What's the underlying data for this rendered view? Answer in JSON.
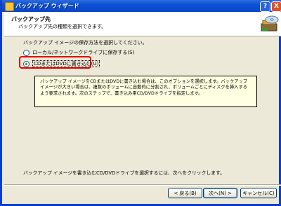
{
  "window": {
    "title": "バックアップ ウィザード",
    "help_label": "?",
    "close_label": "X"
  },
  "header": {
    "title": "バックアップ先",
    "subtitle": "バックアップ先の種類を選択できます。"
  },
  "content": {
    "prompt": "バックアップ イメージの保存方法を選択してください。",
    "options": [
      {
        "label": "ローカル/ネットワークドライブに保存する(S)",
        "selected": false
      },
      {
        "label": "CDまたはDVDに書き込む(U)",
        "selected": true
      }
    ],
    "info_text": "バックアップ イメージをCDまたはDVDに書き込む場合は、このオプションを選択します。バックアップ イメージが大きい場合は、複数のボリュームに自動的に分割され、ボリュームごとにディスクを挿入するよう要求されます。次のステップで、書き込み用CD/DVDドライブを指定します。",
    "footer_note": "バックアップ イメージを書き込むCD/DVDドライブを選択するには、次へをクリックします。"
  },
  "buttons": {
    "back": "< 戻る(B)",
    "next": "次へ(N) >",
    "cancel": "キャンセル(C)"
  },
  "colors": {
    "highlight": "#e60000",
    "titlebar": "#0a51d6"
  }
}
